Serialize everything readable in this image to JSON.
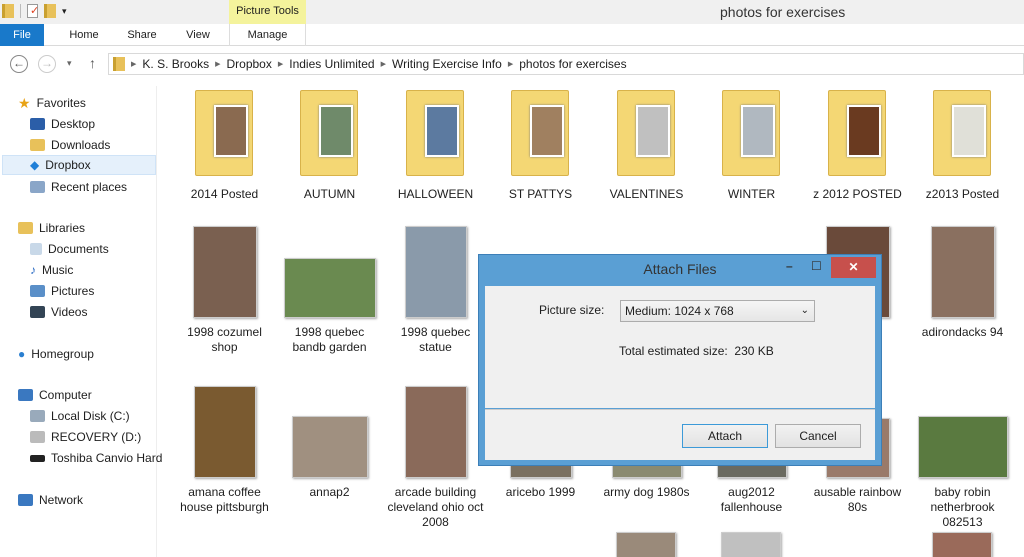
{
  "window": {
    "title": "photos for exercises",
    "context_tab": "Picture Tools"
  },
  "ribbon": {
    "tabs": [
      "File",
      "Home",
      "Share",
      "View",
      "Manage"
    ]
  },
  "address": {
    "crumbs": [
      "K. S. Brooks",
      "Dropbox",
      "Indies Unlimited",
      "Writing Exercise Info",
      "photos for exercises"
    ]
  },
  "sidebar": {
    "favorites": "Favorites",
    "fav_items": [
      "Desktop",
      "Downloads",
      "Dropbox",
      "Recent places"
    ],
    "libraries": "Libraries",
    "lib_items": [
      "Documents",
      "Music",
      "Pictures",
      "Videos"
    ],
    "homegroup": "Homegroup",
    "computer": "Computer",
    "comp_items": [
      "Local Disk (C:)",
      "RECOVERY (D:)",
      "Toshiba Canvio Hard"
    ],
    "network": "Network"
  },
  "folders": [
    "2014 Posted",
    "AUTUMN",
    "HALLOWEEN",
    "ST PATTYS",
    "VALENTINES",
    "WINTER",
    "z 2012 POSTED",
    "z2013 Posted"
  ],
  "row2": [
    "1998 cozumel shop",
    "1998 quebec bandb garden",
    "1998 quebec statue",
    "",
    "",
    "",
    "k 94",
    "adirondacks 94"
  ],
  "row3": [
    "amana coffee house pittsburgh",
    "annap2",
    "arcade building cleveland ohio oct 2008",
    "aricebo 1999",
    "army dog 1980s",
    "aug2012 fallenhouse",
    "ausable rainbow 80s",
    "baby robin netherbrook 082513"
  ],
  "dialog": {
    "title": "Attach Files",
    "size_label": "Picture size:",
    "size_value": "Medium: 1024 x 768",
    "total_label": "Total estimated size:",
    "total_value": "230 KB",
    "attach": "Attach",
    "cancel": "Cancel"
  }
}
